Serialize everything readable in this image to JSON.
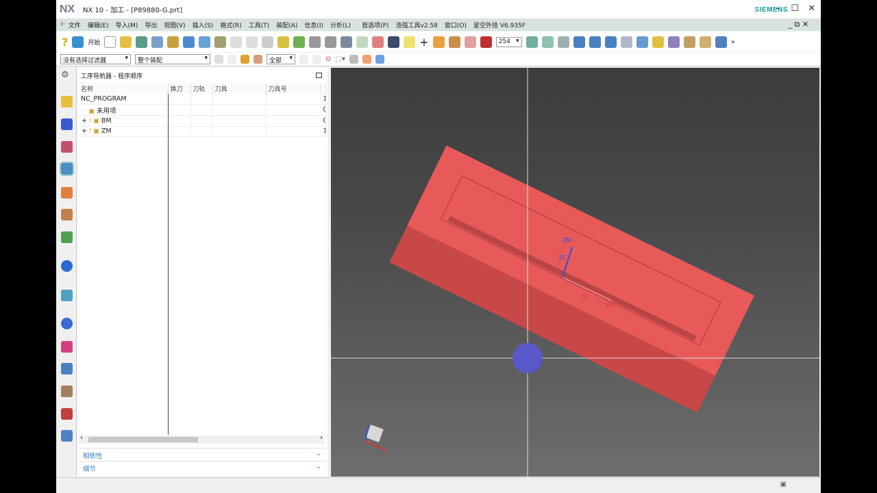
{
  "window": {
    "logo": "NX",
    "title": "NX 10 - 加工 - [P89880-G.prt]",
    "brand": "SIEMENS"
  },
  "menu": [
    "文件",
    "编辑(E)",
    "导入(M)",
    "导出",
    "视图(V)",
    "插入(S)",
    "格式(R)",
    "工具(T)",
    "装配(A)",
    "信息(I)",
    "分析(L)",
    "首选项(P)",
    "浩强工具v2.58",
    "窗口(O)",
    "星空外挂 V6.935F"
  ],
  "toolbar": {
    "start_label": "开始",
    "layer_value": "254"
  },
  "toolbar2": {
    "filter": "没有选择过滤器",
    "scope": "整个装配",
    "select": "全部"
  },
  "navigator": {
    "title": "工序导航器 - 程序顺序",
    "columns": [
      "名称",
      "换刀",
      "刀轨",
      "刀具",
      "刀具号",
      ""
    ],
    "rows": [
      {
        "name": "NC_PROGRAM",
        "last": "1"
      },
      {
        "name": "未用项",
        "last": "0"
      },
      {
        "name": "BM",
        "last": "0"
      },
      {
        "name": "ZM",
        "last": "1"
      }
    ],
    "panels": [
      "相依性",
      "细节"
    ]
  },
  "viewport": {
    "labels": [
      "ZM",
      "ZC",
      "XC",
      "XM"
    ],
    "part_color": "#e85a5a"
  }
}
